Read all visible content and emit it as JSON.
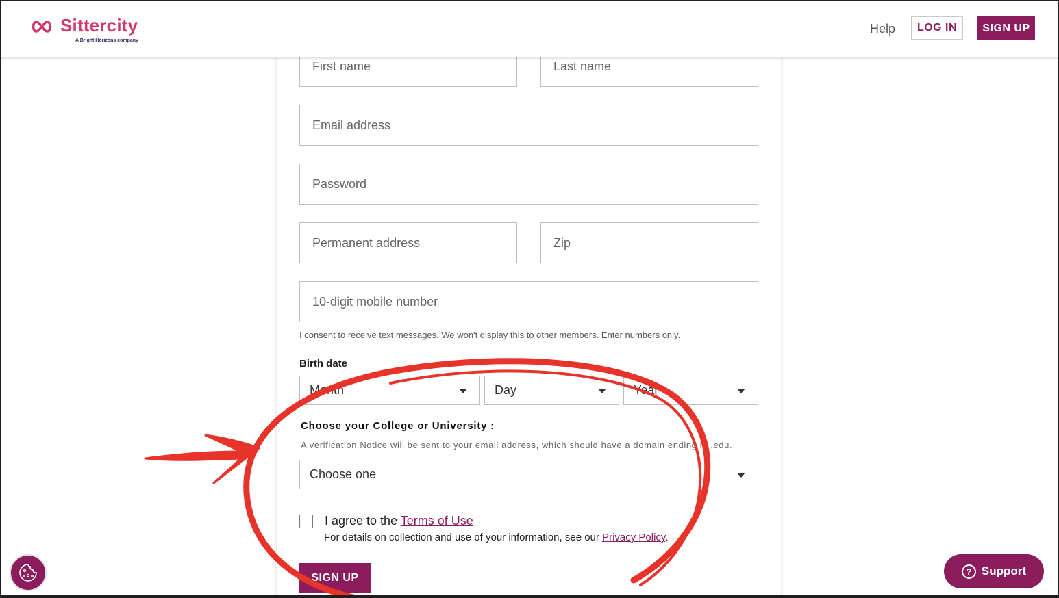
{
  "brand": {
    "name": "Sittercity",
    "tagline": "A Bright Horizons company",
    "color": "#cf3b6a"
  },
  "header": {
    "help_label": "Help",
    "login_label": "LOG IN",
    "signup_label": "SIGN UP"
  },
  "form": {
    "first_name_placeholder": "First name",
    "last_name_placeholder": "Last name",
    "email_placeholder": "Email address",
    "password_placeholder": "Password",
    "address_placeholder": "Permanent address",
    "zip_placeholder": "Zip",
    "mobile_placeholder": "10-digit mobile number",
    "mobile_consent": "I consent to receive text messages. We won't display this to other members. Enter numbers only.",
    "birth_date_label": "Birth date",
    "month_value": "Month",
    "day_value": "Day",
    "year_value": "Year",
    "college_label": "Choose your College or University :",
    "college_notice": "A verification Notice will be sent to your email address, which should have a domain ending in .edu.",
    "college_value": "Choose one",
    "agree_prefix": "I agree to the ",
    "terms_link": "Terms of Use",
    "details_prefix": "For details on collection and use of your information, see our ",
    "privacy_link": "Privacy Policy",
    "details_suffix": ".",
    "submit_label": "SIGN UP"
  },
  "widgets": {
    "support_label": "Support"
  },
  "colors": {
    "primary": "#8b1d5e",
    "annotation": "#e8332a"
  },
  "icons": [
    "infinity-logo-icon",
    "chevron-down-icon",
    "cookie-icon",
    "question-circle-icon"
  ]
}
